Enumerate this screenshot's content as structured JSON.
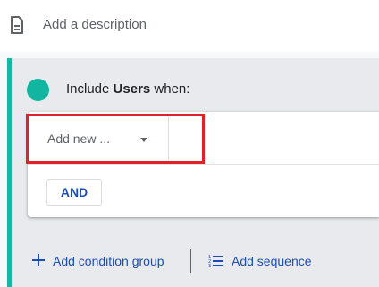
{
  "description": {
    "placeholder": "Add a description",
    "icon": "document-icon"
  },
  "condition_group": {
    "include_prefix": "Include ",
    "include_subject": "Users",
    "include_suffix": " when:",
    "accent_color": "#14b8a6",
    "select": {
      "label": "Add new ...",
      "icon": "chevron-down-icon"
    },
    "and_button": "AND"
  },
  "footer": {
    "add_condition_group": "Add condition group",
    "add_sequence": "Add sequence",
    "link_color": "#1a4db8"
  },
  "highlight_color": "#e0202a"
}
